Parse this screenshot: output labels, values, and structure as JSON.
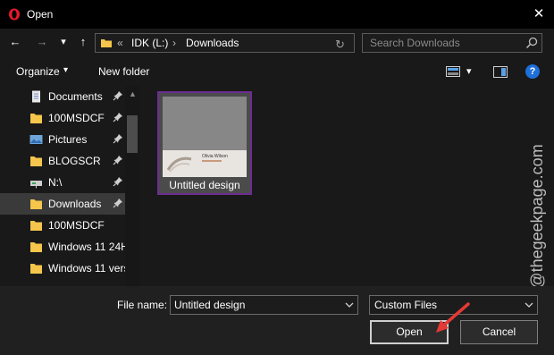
{
  "window": {
    "title": "Open",
    "close_label": "✕"
  },
  "nav": {
    "back_label": "←",
    "forward_label": "→",
    "history_label": "▾",
    "up_label": "↑",
    "address": {
      "overflow": "«",
      "separator": "›",
      "crumbs": [
        "IDK (L:)",
        "Downloads"
      ],
      "refresh_label": "↻"
    },
    "search": {
      "placeholder": "Search Downloads",
      "icon": "search-icon"
    }
  },
  "toolbar": {
    "organize_label": "Organize",
    "organize_arrow": "▾",
    "new_folder_label": "New folder",
    "view_arrow": "▾",
    "help_label": "?"
  },
  "sidebar": {
    "items": [
      {
        "label": "Documents",
        "icon": "documents-icon",
        "pinned": true
      },
      {
        "label": "100MSDCF",
        "icon": "folder-icon",
        "pinned": true
      },
      {
        "label": "Pictures",
        "icon": "pictures-icon",
        "pinned": true
      },
      {
        "label": "BLOGSCR",
        "icon": "folder-icon",
        "pinned": true
      },
      {
        "label": "N:\\",
        "icon": "network-drive-icon",
        "pinned": true
      },
      {
        "label": "Downloads",
        "icon": "folder-icon",
        "pinned": true
      },
      {
        "label": "100MSDCF",
        "icon": "folder-icon",
        "pinned": false
      },
      {
        "label": "Windows 11 24H",
        "icon": "folder-icon",
        "pinned": false
      },
      {
        "label": "Windows 11 vers",
        "icon": "folder-icon",
        "pinned": false
      }
    ],
    "scroll_up": "▲"
  },
  "files": [
    {
      "name": "Untitled design",
      "thumb_text": "Olivia Wilson"
    }
  ],
  "bottom": {
    "file_name_label": "File name:",
    "file_name_value": "Untitled design",
    "file_type_value": "Custom Files",
    "open_label": "Open",
    "cancel_label": "Cancel"
  },
  "watermark": "@thegeekpage.com",
  "colors": {
    "selection_border": "#6c2d91",
    "folder": "#f5c64b",
    "help": "#1e6fd9",
    "arrow": "#e53935",
    "opera_red": "#e51a2c"
  }
}
